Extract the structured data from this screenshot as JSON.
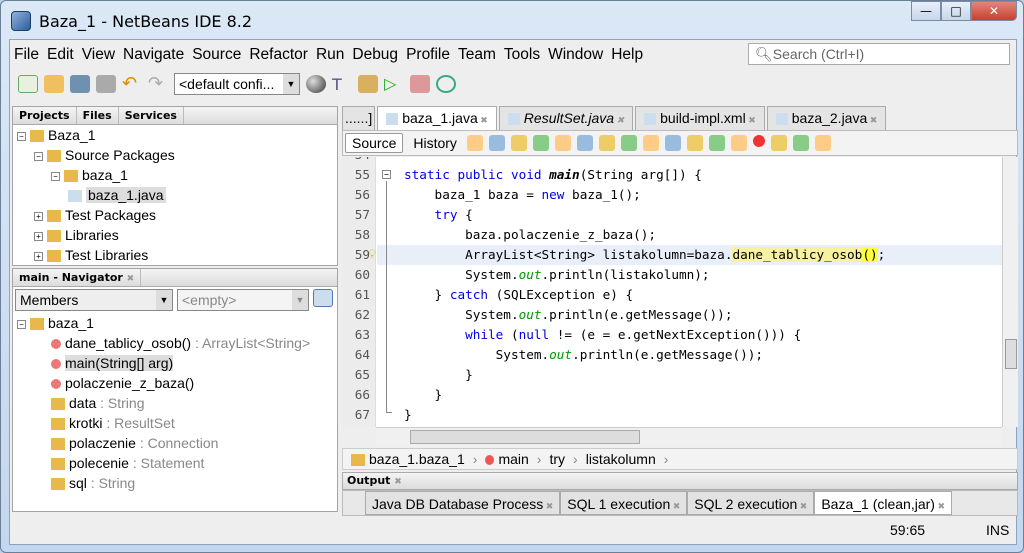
{
  "window": {
    "title": "Baza_1 - NetBeans IDE 8.2",
    "minimize": "—",
    "maximize": "□",
    "close": "✕"
  },
  "menu": [
    "File",
    "Edit",
    "View",
    "Navigate",
    "Source",
    "Refactor",
    "Run",
    "Debug",
    "Profile",
    "Team",
    "Tools",
    "Window",
    "Help"
  ],
  "search": {
    "placeholder": "Search (Ctrl+I)"
  },
  "toolbar": {
    "config": "<default confi..."
  },
  "projects": {
    "tabs": [
      "Projects",
      "Files",
      "Services"
    ],
    "tree": [
      {
        "label": "Baza_1",
        "level": 0
      },
      {
        "label": "Source Packages",
        "level": 1
      },
      {
        "label": "baza_1",
        "level": 2
      },
      {
        "label": "baza_1.java",
        "level": 3,
        "selected": true
      },
      {
        "label": "Test Packages",
        "level": 1
      },
      {
        "label": "Libraries",
        "level": 1
      },
      {
        "label": "Test Libraries",
        "level": 1
      }
    ]
  },
  "navigator": {
    "title": "main - Navigator",
    "filter": "Members",
    "empty": "<empty>",
    "root": "baza_1",
    "members": [
      {
        "name": "dane_tablicy_osob()",
        "type": " : ArrayList<String>",
        "kind": "method"
      },
      {
        "name": "main(String[] arg)",
        "type": "",
        "kind": "method",
        "selected": true
      },
      {
        "name": "polaczenie_z_baza()",
        "type": "",
        "kind": "method"
      },
      {
        "name": "data",
        "type": " : String",
        "kind": "field"
      },
      {
        "name": "krotki",
        "type": " : ResultSet",
        "kind": "field"
      },
      {
        "name": "polaczenie",
        "type": " : Connection",
        "kind": "field"
      },
      {
        "name": "polecenie",
        "type": " : Statement",
        "kind": "field"
      },
      {
        "name": "sql",
        "type": " : String",
        "kind": "field"
      }
    ]
  },
  "editor": {
    "overflow": "......]",
    "tabs": [
      {
        "label": "baza_1.java",
        "active": true
      },
      {
        "label": "ResultSet.java",
        "italic": true
      },
      {
        "label": "build-impl.xml"
      },
      {
        "label": "baza_2.java"
      }
    ],
    "source": "Source",
    "history": "History",
    "lines": [
      {
        "n": "55",
        "t": [
          [
            "kw",
            "static public void "
          ],
          [
            "mb",
            "main"
          ],
          [
            "",
            "(String arg[]) {"
          ]
        ]
      },
      {
        "n": "56",
        "t": [
          [
            "",
            "    baza_1 baza = "
          ],
          [
            "kw",
            "new"
          ],
          [
            "",
            " baza_1();"
          ]
        ]
      },
      {
        "n": "57",
        "t": [
          [
            "kw",
            "    try"
          ],
          [
            "",
            " {"
          ]
        ]
      },
      {
        "n": "58",
        "t": [
          [
            "",
            "        baza.polaczenie_z_baza();"
          ]
        ]
      },
      {
        "n": "59",
        "t": [
          [
            "",
            "        ArrayList<String> listakolumn=baza."
          ],
          [
            "hlm",
            "dane_tablicy_osob"
          ],
          [
            "hlp",
            "()"
          ],
          [
            "",
            ";"
          ]
        ],
        "current": true
      },
      {
        "n": "60",
        "t": [
          [
            "",
            "        System."
          ],
          [
            "fld",
            "out"
          ],
          [
            "",
            ".println(listakolumn);"
          ]
        ]
      },
      {
        "n": "61",
        "t": [
          [
            "",
            "    } "
          ],
          [
            "kw",
            "catch"
          ],
          [
            "",
            " (SQLException e) {"
          ]
        ]
      },
      {
        "n": "62",
        "t": [
          [
            "",
            "        System."
          ],
          [
            "fld",
            "out"
          ],
          [
            "",
            ".println(e.getMessage());"
          ]
        ]
      },
      {
        "n": "63",
        "t": [
          [
            "kw",
            "        while"
          ],
          [
            "",
            " ("
          ],
          [
            "kw",
            "null"
          ],
          [
            "",
            " != (e = e.getNextException())) {"
          ]
        ]
      },
      {
        "n": "64",
        "t": [
          [
            "",
            "            System."
          ],
          [
            "fld",
            "out"
          ],
          [
            "",
            ".println(e.getMessage());"
          ]
        ]
      },
      {
        "n": "65",
        "t": [
          [
            "",
            "        }"
          ]
        ]
      },
      {
        "n": "66",
        "t": [
          [
            "",
            "    }"
          ]
        ]
      },
      {
        "n": "67",
        "t": [
          [
            "",
            "}"
          ]
        ]
      }
    ]
  },
  "breadcrumb": [
    "baza_1.baza_1",
    "main",
    "try",
    "listakolumn"
  ],
  "output": {
    "title": "Output",
    "tabs": [
      {
        "label": "Java DB Database Process"
      },
      {
        "label": "SQL 1 execution"
      },
      {
        "label": "SQL 2 execution"
      },
      {
        "label": "Baza_1 (clean,jar)",
        "active": true
      }
    ]
  },
  "status": {
    "position": "59:65",
    "mode": "INS"
  }
}
